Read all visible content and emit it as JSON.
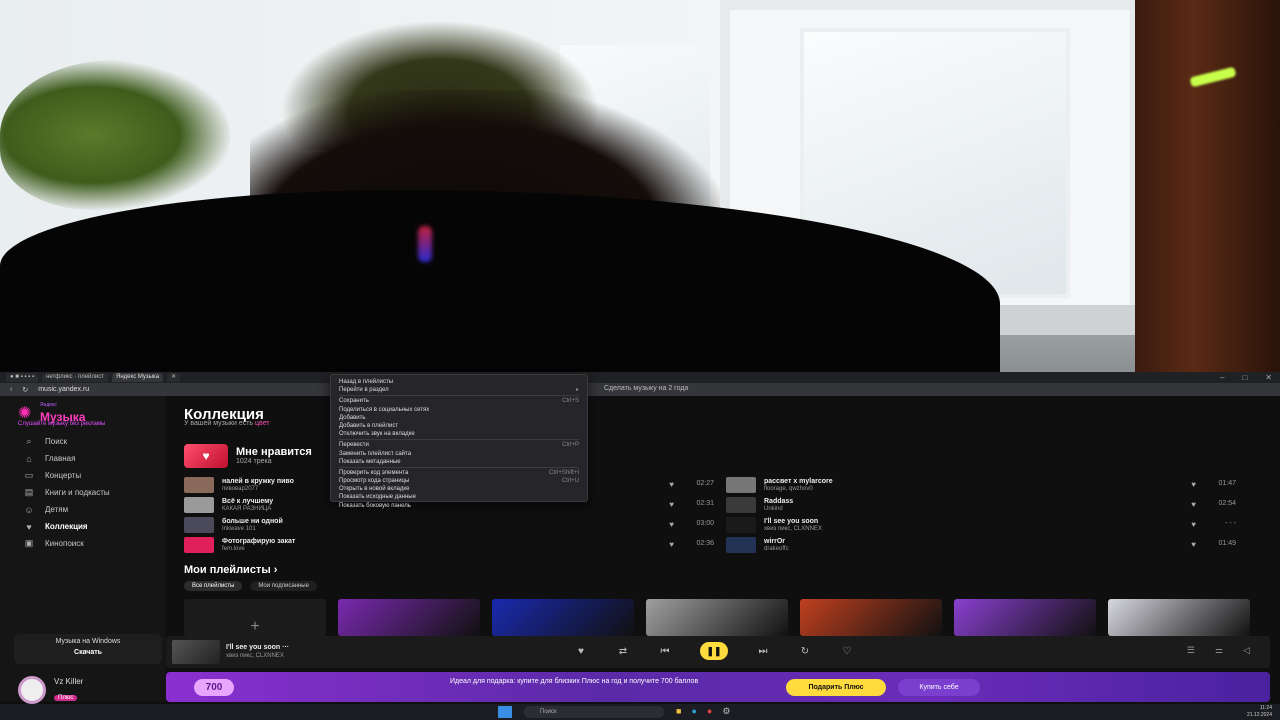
{
  "browser": {
    "tabs": [
      {
        "label": "● ■ ▪ ▪ ▪ ▪"
      },
      {
        "label": "нетфликс · плейлист"
      },
      {
        "label": "Яндекс Музыка"
      },
      {
        "label": "✕"
      }
    ],
    "url": "music.yandex.ru",
    "url_secondary": "Сделать музыку на 2 года",
    "window_controls": [
      "–",
      "□",
      "✕"
    ]
  },
  "context_menu": {
    "items": [
      {
        "label": "Назад в плейлисты",
        "shortcut": ""
      },
      {
        "label": "Перейти в раздел",
        "shortcut": "▸"
      },
      {
        "label": "Сохранить",
        "shortcut": "Ctrl+S"
      },
      {
        "label": "Поделиться в социальных сетях",
        "shortcut": ""
      },
      {
        "label": "Добавить",
        "shortcut": ""
      },
      {
        "label": "Добавить в плейлист",
        "shortcut": ""
      },
      {
        "label": "Отключить звук на вкладке",
        "shortcut": ""
      },
      {
        "label": "Перевести",
        "shortcut": "Ctrl+P"
      },
      {
        "label": "Заменить плейлист сайта",
        "shortcut": ""
      },
      {
        "label": "Показать метаданные",
        "shortcut": ""
      },
      {
        "label": "Проверить код элемента",
        "shortcut": "Ctrl+Shift+I"
      },
      {
        "label": "Просмотр кода страницы",
        "shortcut": "Ctrl+U"
      },
      {
        "label": "Открыть в новой вкладке",
        "shortcut": ""
      },
      {
        "label": "Показать исходные данные",
        "shortcut": ""
      },
      {
        "label": "Показать боковую панель",
        "shortcut": ""
      }
    ]
  },
  "sidebar": {
    "logo_small": "Яндекс",
    "logo_title": "Музыка",
    "tagline": "Слушайте музыку без рекламы",
    "items": [
      {
        "label": "Поиск",
        "icon": "search-icon",
        "glyph": "⌕"
      },
      {
        "label": "Главная",
        "icon": "home-icon",
        "glyph": "⌂"
      },
      {
        "label": "Концерты",
        "icon": "ticket-icon",
        "glyph": "▭"
      },
      {
        "label": "Книги и подкасты",
        "icon": "book-icon",
        "glyph": "▤"
      },
      {
        "label": "Детям",
        "icon": "kids-icon",
        "glyph": "☺"
      },
      {
        "label": "Коллекция",
        "icon": "heart-icon",
        "glyph": "♥"
      },
      {
        "label": "Кинопоиск",
        "icon": "film-icon",
        "glyph": "▣"
      }
    ],
    "windows_promo": {
      "title": "Музыка на Windows",
      "button": "Скачать"
    },
    "user": {
      "name": "Vz Killer",
      "badge": "Плюс"
    }
  },
  "main": {
    "title": "Коллекция",
    "subtitle": "У вашей музыки есть",
    "subtitle_accent": "цвет",
    "liked": {
      "title": "Мне нравится",
      "count": "1024 трека"
    },
    "tracks_left": [
      {
        "title": "налей в кружку пиво",
        "artist": "пивовар2077",
        "duration": "02:27",
        "color": "#8a6a5a"
      },
      {
        "title": "Всё к лучшему",
        "artist": "КАКАЯ РАЗНИЦА",
        "duration": "02:31",
        "color": "#9a9a9a"
      },
      {
        "title": "больше ни одной",
        "artist": "Inkwave 101",
        "duration": "03:00",
        "color": "#4a4a5a"
      },
      {
        "title": "Фотографирую закат",
        "artist": "fem.love",
        "duration": "02:36",
        "color": "#e0205a"
      }
    ],
    "tracks_right": [
      {
        "title": "рассвет x mylarcore",
        "artist": "floorage, qwzhov0",
        "duration": "01:47",
        "color": "#777"
      },
      {
        "title": "Raddass",
        "artist": "Unkind",
        "duration": "02:54",
        "color": "#3a3a3a"
      },
      {
        "title": "I'll see you soon",
        "artist": "хвиз пикс, CLXNNEX",
        "duration": "- - -",
        "color": "#1a1a1a"
      },
      {
        "title": "wirrOr",
        "artist": "drakeoffc",
        "duration": "01:49",
        "color": "#223355"
      }
    ],
    "playlists_title": "Мои плейлисты",
    "playlist_tabs": [
      "Все плейлисты",
      "Мои подписанные"
    ],
    "playlists": [
      {
        "name": "add-playlist",
        "color": "#1c1c1d"
      },
      {
        "name": "playlist-1",
        "color": "#7a2ab0"
      },
      {
        "name": "playlist-2",
        "color": "#1a2ab0"
      },
      {
        "name": "playlist-3",
        "color": "#a0a0a0"
      },
      {
        "name": "playlist-4",
        "color": "#c04020"
      },
      {
        "name": "playlist-5",
        "color": "#8a40d0"
      },
      {
        "name": "playlist-6",
        "color": "#d8d8e0"
      }
    ]
  },
  "player": {
    "title": "I'll see you soon",
    "more": "···",
    "artist": "хвиз пикс, CLXNNEX"
  },
  "promo": {
    "badge": "700",
    "text": "Идеал для подарка: купите для близких Плюс на год и получите 700 баллов",
    "button_primary": "Подарить Плюс",
    "button_secondary": "Купить себе"
  },
  "taskbar": {
    "search": "Поиск",
    "time": "11:24",
    "date": "21.12.2024"
  },
  "colors": {
    "accent": "#ffdb3d",
    "brand": "#ff3ec0",
    "promo": "#8a30d0"
  }
}
